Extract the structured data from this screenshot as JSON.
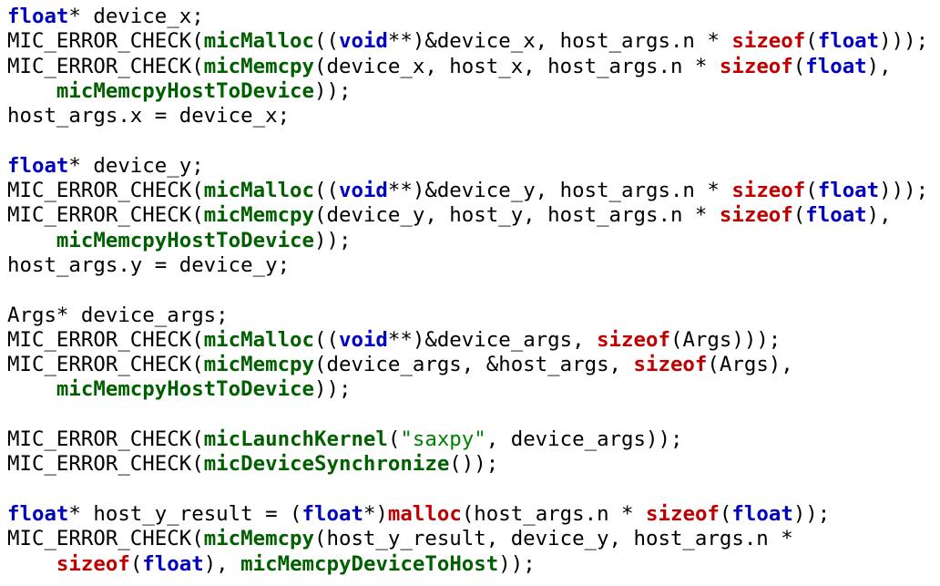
{
  "colors": {
    "type_keyword": "#0000c0",
    "keyword": "#c00000",
    "function": "#006000",
    "string": "#008000",
    "text": "#000000",
    "background": "#ffffff"
  },
  "code_lines": [
    [
      {
        "c": "type",
        "t": "float"
      },
      {
        "c": "plain",
        "t": "* device_x;"
      }
    ],
    [
      {
        "c": "plain",
        "t": "MIC_ERROR_CHECK("
      },
      {
        "c": "fn",
        "t": "micMalloc"
      },
      {
        "c": "plain",
        "t": "(("
      },
      {
        "c": "type",
        "t": "void"
      },
      {
        "c": "plain",
        "t": "**)&device_x, host_args.n * "
      },
      {
        "c": "kw",
        "t": "sizeof"
      },
      {
        "c": "plain",
        "t": "("
      },
      {
        "c": "type",
        "t": "float"
      },
      {
        "c": "plain",
        "t": ")));"
      }
    ],
    [
      {
        "c": "plain",
        "t": "MIC_ERROR_CHECK("
      },
      {
        "c": "fn",
        "t": "micMemcpy"
      },
      {
        "c": "plain",
        "t": "(device_x, host_x, host_args.n * "
      },
      {
        "c": "kw",
        "t": "sizeof"
      },
      {
        "c": "plain",
        "t": "("
      },
      {
        "c": "type",
        "t": "float"
      },
      {
        "c": "plain",
        "t": "),"
      }
    ],
    [
      {
        "c": "plain",
        "t": "    "
      },
      {
        "c": "fn",
        "t": "micMemcpyHostToDevice"
      },
      {
        "c": "plain",
        "t": "));"
      }
    ],
    [
      {
        "c": "plain",
        "t": "host_args.x = device_x;"
      }
    ],
    [],
    [
      {
        "c": "type",
        "t": "float"
      },
      {
        "c": "plain",
        "t": "* device_y;"
      }
    ],
    [
      {
        "c": "plain",
        "t": "MIC_ERROR_CHECK("
      },
      {
        "c": "fn",
        "t": "micMalloc"
      },
      {
        "c": "plain",
        "t": "(("
      },
      {
        "c": "type",
        "t": "void"
      },
      {
        "c": "plain",
        "t": "**)&device_y, host_args.n * "
      },
      {
        "c": "kw",
        "t": "sizeof"
      },
      {
        "c": "plain",
        "t": "("
      },
      {
        "c": "type",
        "t": "float"
      },
      {
        "c": "plain",
        "t": ")));"
      }
    ],
    [
      {
        "c": "plain",
        "t": "MIC_ERROR_CHECK("
      },
      {
        "c": "fn",
        "t": "micMemcpy"
      },
      {
        "c": "plain",
        "t": "(device_y, host_y, host_args.n * "
      },
      {
        "c": "kw",
        "t": "sizeof"
      },
      {
        "c": "plain",
        "t": "("
      },
      {
        "c": "type",
        "t": "float"
      },
      {
        "c": "plain",
        "t": "),"
      }
    ],
    [
      {
        "c": "plain",
        "t": "    "
      },
      {
        "c": "fn",
        "t": "micMemcpyHostToDevice"
      },
      {
        "c": "plain",
        "t": "));"
      }
    ],
    [
      {
        "c": "plain",
        "t": "host_args.y = device_y;"
      }
    ],
    [],
    [
      {
        "c": "plain",
        "t": "Args* device_args;"
      }
    ],
    [
      {
        "c": "plain",
        "t": "MIC_ERROR_CHECK("
      },
      {
        "c": "fn",
        "t": "micMalloc"
      },
      {
        "c": "plain",
        "t": "(("
      },
      {
        "c": "type",
        "t": "void"
      },
      {
        "c": "plain",
        "t": "**)&device_args, "
      },
      {
        "c": "kw",
        "t": "sizeof"
      },
      {
        "c": "plain",
        "t": "(Args)));"
      }
    ],
    [
      {
        "c": "plain",
        "t": "MIC_ERROR_CHECK("
      },
      {
        "c": "fn",
        "t": "micMemcpy"
      },
      {
        "c": "plain",
        "t": "(device_args, &host_args, "
      },
      {
        "c": "kw",
        "t": "sizeof"
      },
      {
        "c": "plain",
        "t": "(Args),"
      }
    ],
    [
      {
        "c": "plain",
        "t": "    "
      },
      {
        "c": "fn",
        "t": "micMemcpyHostToDevice"
      },
      {
        "c": "plain",
        "t": "));"
      }
    ],
    [],
    [
      {
        "c": "plain",
        "t": "MIC_ERROR_CHECK("
      },
      {
        "c": "fn",
        "t": "micLaunchKernel"
      },
      {
        "c": "plain",
        "t": "("
      },
      {
        "c": "str",
        "t": "\"saxpy\""
      },
      {
        "c": "plain",
        "t": ", device_args));"
      }
    ],
    [
      {
        "c": "plain",
        "t": "MIC_ERROR_CHECK("
      },
      {
        "c": "fn",
        "t": "micDeviceSynchronize"
      },
      {
        "c": "plain",
        "t": "());"
      }
    ],
    [],
    [
      {
        "c": "type",
        "t": "float"
      },
      {
        "c": "plain",
        "t": "* host_y_result = ("
      },
      {
        "c": "type",
        "t": "float"
      },
      {
        "c": "plain",
        "t": "*)"
      },
      {
        "c": "kw",
        "t": "malloc"
      },
      {
        "c": "plain",
        "t": "(host_args.n * "
      },
      {
        "c": "kw",
        "t": "sizeof"
      },
      {
        "c": "plain",
        "t": "("
      },
      {
        "c": "type",
        "t": "float"
      },
      {
        "c": "plain",
        "t": "));"
      }
    ],
    [
      {
        "c": "plain",
        "t": "MIC_ERROR_CHECK("
      },
      {
        "c": "fn",
        "t": "micMemcpy"
      },
      {
        "c": "plain",
        "t": "(host_y_result, device_y, host_args.n *"
      }
    ],
    [
      {
        "c": "plain",
        "t": "    "
      },
      {
        "c": "kw",
        "t": "sizeof"
      },
      {
        "c": "plain",
        "t": "("
      },
      {
        "c": "type",
        "t": "float"
      },
      {
        "c": "plain",
        "t": "), "
      },
      {
        "c": "fn",
        "t": "micMemcpyDeviceToHost"
      },
      {
        "c": "plain",
        "t": "));"
      }
    ]
  ]
}
